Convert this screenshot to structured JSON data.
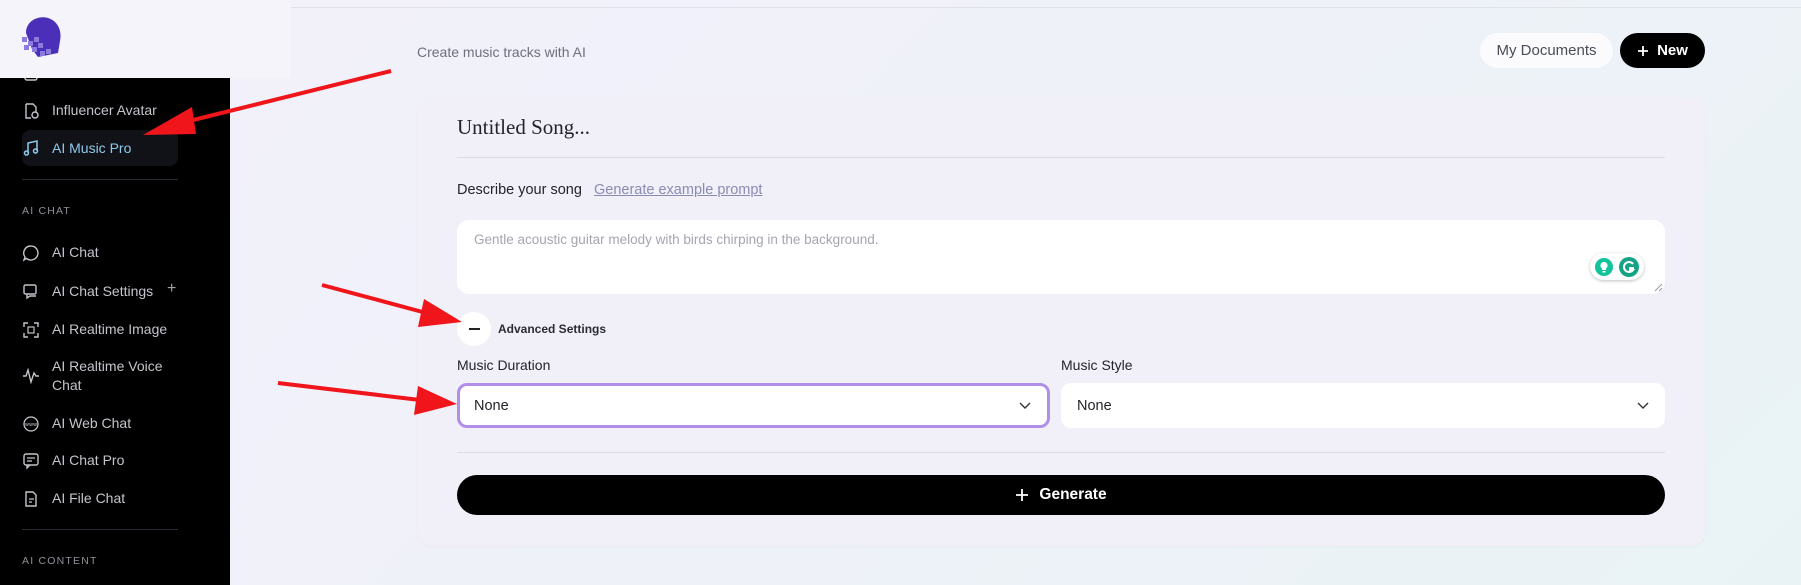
{
  "sidebar": {
    "items_top": [
      {
        "label": "Influencer Avatar",
        "icon": "avatar-star-icon"
      },
      {
        "label": "AI Music Pro",
        "icon": "music-note-icon",
        "active": true
      }
    ],
    "sections": [
      {
        "title": "AI CHAT",
        "items": [
          {
            "label": "AI Chat",
            "icon": "chat-bubble-icon"
          },
          {
            "label": "AI Chat Settings",
            "icon": "chat-settings-icon"
          },
          {
            "label": "AI Realtime Image",
            "icon": "realtime-image-icon"
          },
          {
            "label": "AI Realtime Voice Chat",
            "icon": "voice-wave-icon"
          },
          {
            "label": "AI Web Chat",
            "icon": "www-globe-icon"
          },
          {
            "label": "AI Chat Pro",
            "icon": "chat-pro-icon"
          },
          {
            "label": "AI File Chat",
            "icon": "file-chat-icon"
          }
        ]
      },
      {
        "title": "AI CONTENT",
        "items": []
      }
    ],
    "plus_symbol": "+"
  },
  "header": {
    "subtitle": "Create music tracks with AI",
    "my_documents_label": "My Documents",
    "new_label": "New"
  },
  "editor": {
    "song_title": "Untitled Song...",
    "describe_label": "Describe your song",
    "example_link": "Generate example prompt",
    "prompt_placeholder": "Gentle acoustic guitar melody with birds chirping in the background.",
    "advanced_label": "Advanced Settings",
    "duration": {
      "label": "Music Duration",
      "value": "None"
    },
    "style": {
      "label": "Music Style",
      "value": "None"
    },
    "generate_label": "Generate"
  },
  "colors": {
    "accent_active": "#8fc9ea",
    "focus_ring": "#b18ee8",
    "annotation_arrow": "#f0151a",
    "logo_purple": "#4b2fb8"
  }
}
